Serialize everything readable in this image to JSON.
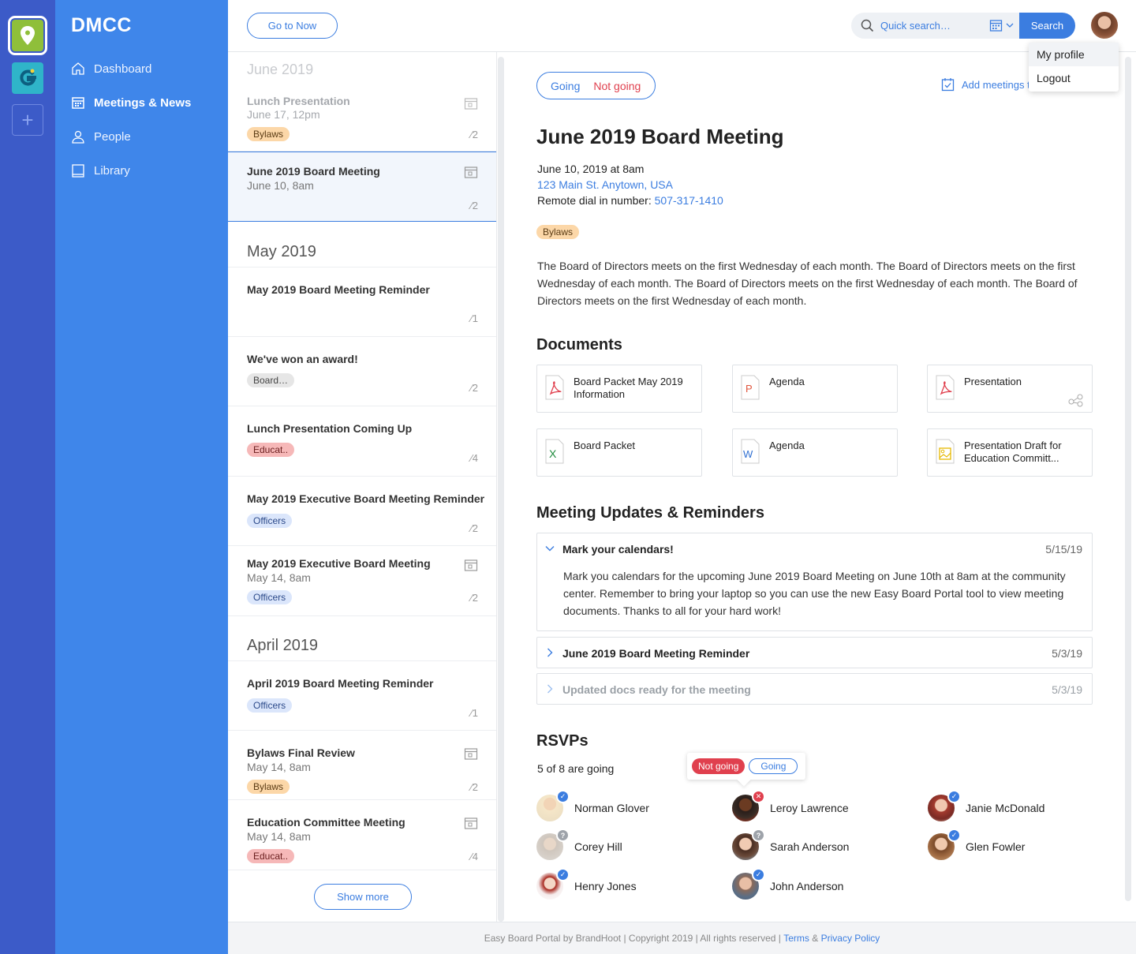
{
  "org_name": "DMCC",
  "sidebar": {
    "items": [
      {
        "label": "Dashboard",
        "icon": "home-icon"
      },
      {
        "label": "Meetings & News",
        "icon": "calendar-icon"
      },
      {
        "label": "People",
        "icon": "person-icon"
      },
      {
        "label": "Library",
        "icon": "book-icon"
      }
    ]
  },
  "topbar": {
    "go_now_label": "Go to Now",
    "search_placeholder": "Quick search…",
    "search_label": "Search"
  },
  "user_menu": {
    "my_profile": "My profile",
    "logout": "Logout"
  },
  "list": {
    "months": [
      "June 2019",
      "May 2019",
      "April 2019"
    ],
    "items": [
      {
        "title": "Lunch Presentation",
        "sub": "June 17, 12pm",
        "tag": "Bylaws",
        "att": "2"
      },
      {
        "title": "June 2019 Board Meeting",
        "sub": "June 10, 8am",
        "tag": "",
        "att": "2"
      },
      {
        "title": "May 2019 Board Meeting Reminder",
        "sub": "",
        "tag": "",
        "att": "1"
      },
      {
        "title": "We've won an award!",
        "sub": "",
        "tag": "Board…",
        "att": "2"
      },
      {
        "title": "Lunch Presentation Coming Up",
        "sub": "",
        "tag": "Educat..",
        "att": "4"
      },
      {
        "title": "May 2019 Executive Board Meeting Reminder",
        "sub": "",
        "tag": "Officers",
        "att": "2"
      },
      {
        "title": "May 2019 Executive Board Meeting",
        "sub": "May 14, 8am",
        "tag": "Officers",
        "att": "2"
      },
      {
        "title": "April 2019 Board Meeting Reminder",
        "sub": "",
        "tag": "Officers",
        "att": "1"
      },
      {
        "title": "Bylaws Final Review",
        "sub": "May 14, 8am",
        "tag": "Bylaws",
        "att": "2"
      },
      {
        "title": "Education Committee Meeting",
        "sub": "May 14, 8am",
        "tag": "Educat..",
        "att": "4"
      }
    ],
    "show_more": "Show more"
  },
  "detail": {
    "rsvp_going": "Going",
    "rsvp_not_going": "Not going",
    "add_meetings": "Add meetings to",
    "title": "June 2019 Board Meeting",
    "datetime": "June 10, 2019 at 8am",
    "address": "123 Main St. Anytown, USA",
    "dial_label": "Remote dial in number:",
    "dial_number": "507-317-1410",
    "tag": "Bylaws",
    "description": "The Board of Directors meets on the first Wednesday of each month.  The Board of Directors meets on the first Wednesday of each month.  The Board of Directors meets on the first Wednesday of each month. The Board of Directors meets on the first Wednesday of each month.",
    "documents_heading": "Documents",
    "documents": [
      {
        "name": "Board Packet May 2019 Information",
        "type": "pdf"
      },
      {
        "name": "Agenda",
        "type": "ppt"
      },
      {
        "name": "Presentation",
        "type": "pdf"
      },
      {
        "name": "Board Packet",
        "type": "xls"
      },
      {
        "name": "Agenda",
        "type": "doc"
      },
      {
        "name": "Presentation Draft for Education Committ...",
        "type": "img"
      }
    ],
    "updates_heading": "Meeting Updates & Reminders",
    "updates": [
      {
        "title": "Mark your calendars!",
        "date": "5/15/19",
        "body": "Mark you calendars for the upcoming June 2019 Board Meeting on June 10th at 8am at the community center. Remember to bring your laptop so you can use the new Easy Board Portal tool to view meeting documents. Thanks to all for your hard work!"
      },
      {
        "title": "June 2019 Board Meeting Reminder",
        "date": "5/3/19"
      },
      {
        "title": "Updated docs ready for the meeting",
        "date": "5/3/19"
      }
    ],
    "rsvps_heading": "RSVPs",
    "rsvps_count": "5 of 8 are going",
    "popover_not_going": "Not going",
    "popover_going": "Going",
    "people": [
      {
        "name": "Norman Glover",
        "status": "yes"
      },
      {
        "name": "Leroy Lawrence",
        "status": "no"
      },
      {
        "name": "Janie McDonald",
        "status": "yes"
      },
      {
        "name": "Corey Hill",
        "status": "unknown"
      },
      {
        "name": "Sarah Anderson",
        "status": "unknown"
      },
      {
        "name": "Glen Fowler",
        "status": "yes"
      },
      {
        "name": "Henry Jones",
        "status": "yes"
      },
      {
        "name": "John Anderson",
        "status": "yes"
      }
    ]
  },
  "footer": {
    "text": "Easy Board Portal by BrandHoot | Copyright 2019 | All rights reserved |",
    "terms": "Terms",
    "amp": "&",
    "privacy": "Privacy Policy"
  }
}
